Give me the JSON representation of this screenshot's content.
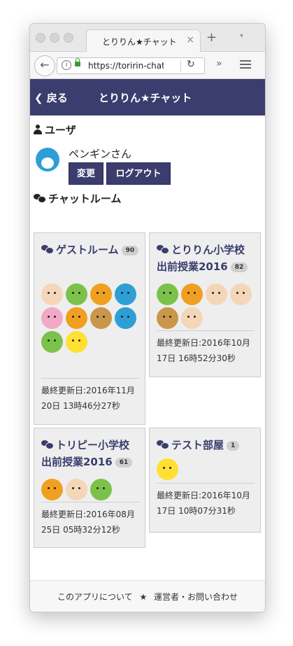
{
  "browser": {
    "tab_title": "とりりん★チャット",
    "tab_close": "×",
    "new_tab": "+",
    "tab_menu": "▾",
    "url": "https://toririn-chat",
    "back_glyph": "←",
    "info_glyph": "i",
    "reload_glyph": "↻",
    "overflow_glyph": "»"
  },
  "header": {
    "back_label": "❮ 戻る",
    "title": "とりりん★チャット"
  },
  "user_section": {
    "heading": "ユーザ",
    "username": "ペンギンさん",
    "change_label": "変更",
    "logout_label": "ログアウト"
  },
  "rooms_section": {
    "heading": "チャットルーム"
  },
  "rooms": [
    {
      "title": "ゲストルーム",
      "count": "90",
      "avatars": [
        "girl",
        "boy-green-cap",
        "tiger",
        "penguin",
        "rabbit",
        "tiger",
        "hamster",
        "penguin",
        "boy-green-cap",
        "chick"
      ],
      "updated": "最終更新日:2016年11月20日 13時46分27秒"
    },
    {
      "title": "とりりん小学校出前授業2016",
      "count": "82",
      "avatars": [
        "boy-green-cap",
        "tiger",
        "girl",
        "man",
        "hamster",
        "woman"
      ],
      "updated": "最終更新日:2016年10月17日 16時52分30秒"
    },
    {
      "title": "トリピー小学校出前授業2016",
      "count": "61",
      "avatars": [
        "tiger",
        "girl",
        "boy-green-cap"
      ],
      "updated": "最終更新日:2016年08月25日 05時32分12秒"
    },
    {
      "title": "テスト部屋",
      "count": "1",
      "avatars": [
        "chick"
      ],
      "updated": "最終更新日:2016年10月17日 10時07分31秒"
    }
  ],
  "footer": {
    "about": "このアプリについて",
    "separator": "★",
    "contact": "運営者・お問い合わせ"
  },
  "colors": {
    "brand": "#3a3d6e",
    "card_bg": "#eeeeee"
  }
}
